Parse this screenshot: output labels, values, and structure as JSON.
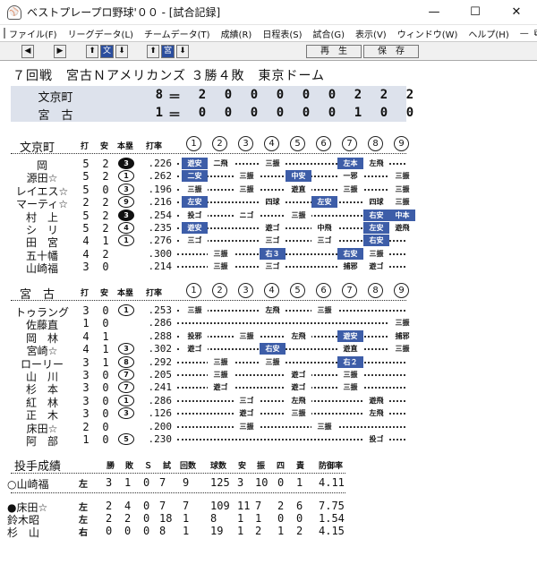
{
  "window": {
    "title": "ベストプレープロ野球'００ - [試合記録]",
    "minimize": "—",
    "maximize": "☐",
    "close": "✕"
  },
  "menu": [
    "ファイル(F)",
    "リーグデータ(L)",
    "チームデータ(T)",
    "成績(R)",
    "日程表(S)",
    "試合(G)",
    "表示(V)",
    "ウィンドウ(W)",
    "ヘルプ(H)"
  ],
  "mdi": {
    "minimize": "—",
    "restore": "⧉",
    "close": "✕"
  },
  "toolbar": {
    "prev": "◀",
    "next": "▶",
    "up1": "⬆",
    "team1": "文",
    "down1": "⬇",
    "up2": "⬆",
    "team2": "宮",
    "down2": "⬇",
    "replay": "再　生",
    "save": "保　存"
  },
  "game": {
    "info": "７回戦　宮古Ｎアメリカンズ ３勝４敗　東京ドーム"
  },
  "linescore": {
    "eq": "＝",
    "teams": [
      {
        "name": "文京町",
        "total": "8",
        "innings": [
          "2",
          "0",
          "0",
          "0",
          "0",
          "0",
          "2",
          "2",
          "2"
        ]
      },
      {
        "name": "宮　古",
        "total": "1",
        "innings": [
          "0",
          "0",
          "0",
          "0",
          "0",
          "0",
          "1",
          "0",
          "0"
        ]
      }
    ]
  },
  "batting_headers": {
    "ab": "打",
    "h": "安",
    "hr": "本塁",
    "avg": "打率"
  },
  "inning_labels": [
    "1",
    "2",
    "3",
    "4",
    "5",
    "6",
    "7",
    "8",
    "9"
  ],
  "home": {
    "team": "文京町",
    "players": [
      {
        "name": "岡",
        "ab": "5",
        "h": "2",
        "hr": "3",
        "hr_filled": true,
        "avg": ".226",
        "cells": [
          {
            "t": "遊安",
            "hit": true
          },
          {
            "t": "二飛"
          },
          null,
          {
            "t": "三振"
          },
          null,
          null,
          {
            "t": "左本",
            "hit": true
          },
          {
            "t": "左飛"
          },
          null
        ]
      },
      {
        "name": "源田☆",
        "ab": "5",
        "h": "2",
        "hr": "1",
        "hr_filled": false,
        "avg": ".262",
        "cells": [
          {
            "t": "二安",
            "hit": true
          },
          null,
          {
            "t": "三振"
          },
          null,
          {
            "t": "中安",
            "hit": true
          },
          null,
          {
            "t": "一邪"
          },
          null,
          {
            "t": "三振"
          }
        ]
      },
      {
        "name": "レイエス☆",
        "ab": "5",
        "h": "0",
        "hr": "3",
        "hr_filled": false,
        "avg": ".196",
        "cells": [
          {
            "t": "三振"
          },
          null,
          {
            "t": "三振"
          },
          null,
          {
            "t": "遊直"
          },
          null,
          {
            "t": "三振"
          },
          null,
          {
            "t": "三振"
          }
        ]
      },
      {
        "name": "マーティ☆",
        "ab": "2",
        "h": "2",
        "hr": "9",
        "hr_filled": false,
        "avg": ".216",
        "cells": [
          {
            "t": "左安",
            "hit": true
          },
          null,
          null,
          {
            "t": "四球"
          },
          null,
          {
            "t": "左安",
            "hit": true
          },
          null,
          {
            "t": "四球"
          },
          {
            "t": "三振"
          }
        ]
      },
      {
        "name": "村　上",
        "ab": "5",
        "h": "2",
        "hr": "3",
        "hr_filled": true,
        "avg": ".254",
        "cells": [
          {
            "t": "投ゴ"
          },
          null,
          {
            "t": "ニゴ"
          },
          null,
          {
            "t": "三振"
          },
          null,
          null,
          {
            "t": "右安",
            "hit": true
          },
          {
            "t": "中本",
            "hit": true
          }
        ]
      },
      {
        "name": "シ　リ",
        "ab": "5",
        "h": "2",
        "hr": "4",
        "hr_filled": false,
        "avg": ".235",
        "cells": [
          {
            "t": "遊安",
            "hit": true
          },
          null,
          null,
          {
            "t": "遊ゴ"
          },
          null,
          {
            "t": "中飛"
          },
          null,
          {
            "t": "左安",
            "hit": true
          },
          {
            "t": "遊飛"
          }
        ]
      },
      {
        "name": "田　宮",
        "ab": "4",
        "h": "1",
        "hr": "1",
        "hr_filled": false,
        "avg": ".276",
        "cells": [
          {
            "t": "三ゴ"
          },
          null,
          null,
          {
            "t": "三ゴ"
          },
          null,
          {
            "t": "三ゴ"
          },
          null,
          {
            "t": "右安",
            "hit": true
          },
          null
        ]
      },
      {
        "name": "五十幡",
        "ab": "4",
        "h": "2",
        "hr": "",
        "hr_filled": false,
        "avg": ".300",
        "cells": [
          null,
          {
            "t": "三振"
          },
          null,
          {
            "t": "右３",
            "hit": true
          },
          null,
          null,
          {
            "t": "右安",
            "hit": true
          },
          {
            "t": "三振"
          },
          null
        ]
      },
      {
        "name": "山崎福",
        "ab": "3",
        "h": "0",
        "hr": "",
        "hr_filled": false,
        "avg": ".214",
        "cells": [
          null,
          {
            "t": "三振"
          },
          null,
          {
            "t": "三ゴ"
          },
          null,
          null,
          {
            "t": "捕邪"
          },
          {
            "t": "遊ゴ"
          },
          null
        ]
      }
    ]
  },
  "away": {
    "team": "宮　古",
    "players": [
      {
        "name": "トゥラング",
        "ab": "3",
        "h": "0",
        "hr": "1",
        "hr_filled": false,
        "avg": ".253",
        "cells": [
          {
            "t": "三振"
          },
          null,
          null,
          {
            "t": "左飛"
          },
          null,
          {
            "t": "三振"
          },
          null,
          null,
          null
        ]
      },
      {
        "name": "佐藤直",
        "ab": "1",
        "h": "0",
        "hr": "",
        "hr_filled": false,
        "avg": ".286",
        "cells": [
          null,
          null,
          null,
          null,
          null,
          null,
          null,
          null,
          {
            "t": "三振"
          }
        ]
      },
      {
        "name": "岡　林",
        "ab": "4",
        "h": "1",
        "hr": "",
        "hr_filled": false,
        "avg": ".288",
        "cells": [
          {
            "t": "投邪"
          },
          null,
          {
            "t": "三振"
          },
          null,
          {
            "t": "左飛"
          },
          null,
          {
            "t": "遊安",
            "hit": true
          },
          null,
          {
            "t": "捕邪"
          }
        ]
      },
      {
        "name": "宮崎☆",
        "ab": "4",
        "h": "1",
        "hr": "3",
        "hr_filled": false,
        "avg": ".302",
        "cells": [
          {
            "t": "遊ゴ"
          },
          null,
          null,
          {
            "t": "右安",
            "hit": true
          },
          null,
          null,
          {
            "t": "遊直"
          },
          null,
          {
            "t": "三振"
          }
        ]
      },
      {
        "name": "ローリー",
        "ab": "3",
        "h": "1",
        "hr": "8",
        "hr_filled": false,
        "avg": ".292",
        "cells": [
          null,
          {
            "t": "三振"
          },
          null,
          {
            "t": "三振"
          },
          null,
          null,
          {
            "t": "右２",
            "hit": true
          },
          null,
          null
        ]
      },
      {
        "name": "山　川",
        "ab": "3",
        "h": "0",
        "hr": "7",
        "hr_filled": false,
        "avg": ".205",
        "cells": [
          null,
          {
            "t": "三振"
          },
          null,
          null,
          {
            "t": "遊ゴ"
          },
          null,
          {
            "t": "三振"
          },
          null,
          null
        ]
      },
      {
        "name": "杉　本",
        "ab": "3",
        "h": "0",
        "hr": "7",
        "hr_filled": false,
        "avg": ".241",
        "cells": [
          null,
          {
            "t": "遊ゴ"
          },
          null,
          null,
          {
            "t": "遊ゴ"
          },
          null,
          {
            "t": "三振"
          },
          null,
          null
        ]
      },
      {
        "name": "紅　林",
        "ab": "3",
        "h": "0",
        "hr": "1",
        "hr_filled": false,
        "avg": ".286",
        "cells": [
          null,
          null,
          {
            "t": "三ゴ"
          },
          null,
          {
            "t": "左飛"
          },
          null,
          null,
          {
            "t": "遊飛"
          },
          null
        ]
      },
      {
        "name": "正　木",
        "ab": "3",
        "h": "0",
        "hr": "3",
        "hr_filled": false,
        "avg": ".126",
        "cells": [
          null,
          null,
          {
            "t": "遊ゴ"
          },
          null,
          {
            "t": "三振"
          },
          null,
          null,
          {
            "t": "左飛"
          },
          null
        ]
      },
      {
        "name": "床田☆",
        "ab": "2",
        "h": "0",
        "hr": "",
        "hr_filled": false,
        "avg": ".200",
        "cells": [
          null,
          null,
          {
            "t": "三振"
          },
          null,
          null,
          {
            "t": "三振"
          },
          null,
          null,
          null
        ]
      },
      {
        "name": "阿　部",
        "ab": "1",
        "h": "0",
        "hr": "5",
        "hr_filled": false,
        "avg": ".230",
        "cells": [
          null,
          null,
          null,
          null,
          null,
          null,
          null,
          {
            "t": "投ゴ"
          },
          null
        ]
      }
    ]
  },
  "pitching": {
    "title": "投手成績",
    "headers": {
      "w": "勝",
      "l": "敗",
      "s": "Ｓ",
      "g": "試",
      "ip": "回数",
      "np": "球数",
      "h": "安",
      "k": "振",
      "bb": "四",
      "er": "責",
      "era": "防御率"
    },
    "home": [
      {
        "name": "○山崎福",
        "hand": "左",
        "w": "3",
        "l": "1",
        "s": "0",
        "g": "7",
        "ip": "9",
        "np": "125",
        "h": "3",
        "k": "10",
        "bb": "0",
        "er": "1",
        "era": "4.11"
      }
    ],
    "away": [
      {
        "name": "●床田☆",
        "hand": "左",
        "w": "2",
        "l": "4",
        "s": "0",
        "g": "7",
        "ip": "7",
        "np": "109",
        "h": "11",
        "k": "7",
        "bb": "2",
        "er": "6",
        "era": "7.75"
      },
      {
        "name": "鈴木昭",
        "hand": "左",
        "w": "2",
        "l": "2",
        "s": "0",
        "g": "18",
        "ip": "1",
        "np": "8",
        "h": "1",
        "k": "1",
        "bb": "0",
        "er": "0",
        "era": "1.54"
      },
      {
        "name": "杉　山",
        "hand": "右",
        "w": "0",
        "l": "0",
        "s": "0",
        "g": "8",
        "ip": "1",
        "np": "19",
        "h": "1",
        "k": "2",
        "bb": "1",
        "er": "2",
        "era": "4.15"
      }
    ]
  }
}
